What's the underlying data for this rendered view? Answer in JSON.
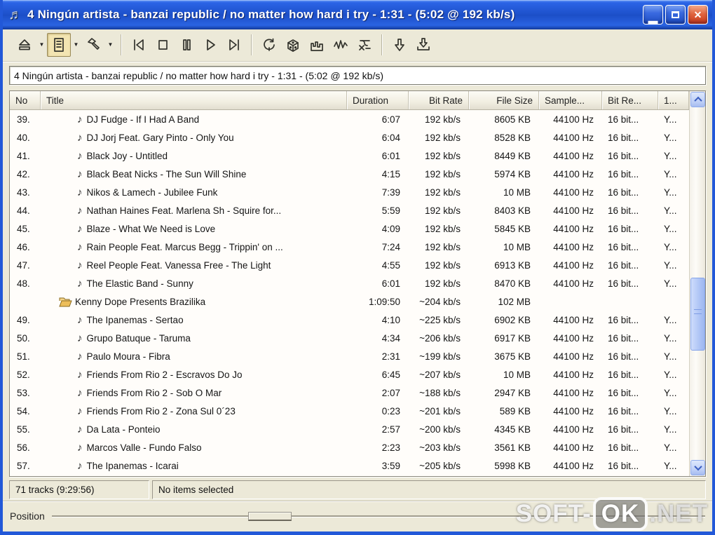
{
  "window": {
    "title": "4 Ningún artista - banzai republic / no matter how hard i try - 1:31 - (5:02 @ 192 kb/s)",
    "controls": {
      "minimize": "_",
      "maximize": "",
      "close": "X"
    }
  },
  "toolbar": {
    "icons": [
      "eject",
      "playlist-view",
      "tools",
      "previous-track",
      "stop",
      "pause",
      "play",
      "next-track",
      "repeat",
      "shuffle-dice",
      "spectrum",
      "waveform",
      "cut",
      "download-arrow",
      "save-arrow"
    ],
    "active_button": "playlist-view"
  },
  "now_playing_field": {
    "value": "4 Ningún artista - banzai republic / no matter how hard i try - 1:31 - (5:02 @ 192 kb/s)"
  },
  "playlist": {
    "columns": [
      {
        "label": "No",
        "align": "l"
      },
      {
        "label": "Title",
        "align": "l"
      },
      {
        "label": "Duration",
        "align": "l"
      },
      {
        "label": "Bit Rate",
        "align": "r"
      },
      {
        "label": "File Size",
        "align": "r"
      },
      {
        "label": "Sample...",
        "align": "l"
      },
      {
        "label": "Bit Re...",
        "align": "l"
      },
      {
        "label": "1...",
        "align": "l"
      }
    ],
    "rows": [
      {
        "no": "39.",
        "type": "track",
        "title": "DJ Fudge - If I Had A Band",
        "duration": "6:07",
        "bitrate": "192 kb/s",
        "size": "8605 KB",
        "sample": "44100 Hz",
        "bits": "16 bit...",
        "more": "Y..."
      },
      {
        "no": "40.",
        "type": "track",
        "title": "DJ Jorj Feat. Gary Pinto - Only You",
        "duration": "6:04",
        "bitrate": "192 kb/s",
        "size": "8528 KB",
        "sample": "44100 Hz",
        "bits": "16 bit...",
        "more": "Y..."
      },
      {
        "no": "41.",
        "type": "track",
        "title": "Black Joy - Untitled",
        "duration": "6:01",
        "bitrate": "192 kb/s",
        "size": "8449 KB",
        "sample": "44100 Hz",
        "bits": "16 bit...",
        "more": "Y..."
      },
      {
        "no": "42.",
        "type": "track",
        "title": "Black Beat Nicks - The Sun Will Shine",
        "duration": "4:15",
        "bitrate": "192 kb/s",
        "size": "5974 KB",
        "sample": "44100 Hz",
        "bits": "16 bit...",
        "more": "Y..."
      },
      {
        "no": "43.",
        "type": "track",
        "title": "Nikos & Lamech - Jubilee Funk",
        "duration": "7:39",
        "bitrate": "192 kb/s",
        "size": "10 MB",
        "sample": "44100 Hz",
        "bits": "16 bit...",
        "more": "Y..."
      },
      {
        "no": "44.",
        "type": "track",
        "title": "Nathan Haines Feat. Marlena Sh - Squire for...",
        "duration": "5:59",
        "bitrate": "192 kb/s",
        "size": "8403 KB",
        "sample": "44100 Hz",
        "bits": "16 bit...",
        "more": "Y..."
      },
      {
        "no": "45.",
        "type": "track",
        "title": "Blaze - What We Need is Love",
        "duration": "4:09",
        "bitrate": "192 kb/s",
        "size": "5845 KB",
        "sample": "44100 Hz",
        "bits": "16 bit...",
        "more": "Y..."
      },
      {
        "no": "46.",
        "type": "track",
        "title": "Rain People Feat. Marcus Begg - Trippin' on ...",
        "duration": "7:24",
        "bitrate": "192 kb/s",
        "size": "10 MB",
        "sample": "44100 Hz",
        "bits": "16 bit...",
        "more": "Y..."
      },
      {
        "no": "47.",
        "type": "track",
        "title": "Reel People Feat. Vanessa Free - The Light",
        "duration": "4:55",
        "bitrate": "192 kb/s",
        "size": "6913 KB",
        "sample": "44100 Hz",
        "bits": "16 bit...",
        "more": "Y..."
      },
      {
        "no": "48.",
        "type": "track",
        "title": "The Elastic Band - Sunny",
        "duration": "6:01",
        "bitrate": "192 kb/s",
        "size": "8470 KB",
        "sample": "44100 Hz",
        "bits": "16 bit...",
        "more": "Y..."
      },
      {
        "no": "",
        "type": "folder",
        "title": "Kenny Dope Presents Brazilika",
        "duration": "1:09:50",
        "bitrate": "~204 kb/s",
        "size": "102 MB",
        "sample": "",
        "bits": "",
        "more": ""
      },
      {
        "no": "49.",
        "type": "track",
        "title": "The Ipanemas - Sertao",
        "duration": "4:10",
        "bitrate": "~225 kb/s",
        "size": "6902 KB",
        "sample": "44100 Hz",
        "bits": "16 bit...",
        "more": "Y..."
      },
      {
        "no": "50.",
        "type": "track",
        "title": "Grupo Batuque - Taruma",
        "duration": "4:34",
        "bitrate": "~206 kb/s",
        "size": "6917 KB",
        "sample": "44100 Hz",
        "bits": "16 bit...",
        "more": "Y..."
      },
      {
        "no": "51.",
        "type": "track",
        "title": "Paulo Moura - Fibra",
        "duration": "2:31",
        "bitrate": "~199 kb/s",
        "size": "3675 KB",
        "sample": "44100 Hz",
        "bits": "16 bit...",
        "more": "Y..."
      },
      {
        "no": "52.",
        "type": "track",
        "title": "Friends From Rio 2 - Escravos Do Jo",
        "duration": "6:45",
        "bitrate": "~207 kb/s",
        "size": "10 MB",
        "sample": "44100 Hz",
        "bits": "16 bit...",
        "more": "Y..."
      },
      {
        "no": "53.",
        "type": "track",
        "title": "Friends From Rio 2 - Sob O Mar",
        "duration": "2:07",
        "bitrate": "~188 kb/s",
        "size": "2947 KB",
        "sample": "44100 Hz",
        "bits": "16 bit...",
        "more": "Y..."
      },
      {
        "no": "54.",
        "type": "track",
        "title": "Friends From Rio 2 - Zona Sul 0´23",
        "duration": "0:23",
        "bitrate": "~201 kb/s",
        "size": "589 KB",
        "sample": "44100 Hz",
        "bits": "16 bit...",
        "more": "Y..."
      },
      {
        "no": "55.",
        "type": "track",
        "title": "Da Lata - Ponteio",
        "duration": "2:57",
        "bitrate": "~200 kb/s",
        "size": "4345 KB",
        "sample": "44100 Hz",
        "bits": "16 bit...",
        "more": "Y..."
      },
      {
        "no": "56.",
        "type": "track",
        "title": "Marcos Valle - Fundo Falso",
        "duration": "2:23",
        "bitrate": "~203 kb/s",
        "size": "3561 KB",
        "sample": "44100 Hz",
        "bits": "16 bit...",
        "more": "Y..."
      },
      {
        "no": "57.",
        "type": "track",
        "title": "The Ipanemas - Icarai",
        "duration": "3:59",
        "bitrate": "~205 kb/s",
        "size": "5998 KB",
        "sample": "44100 Hz",
        "bits": "16 bit...",
        "more": "Y..."
      }
    ]
  },
  "status_bar": {
    "tracks_summary": "71 tracks (9:29:56)",
    "selection": "No items selected"
  },
  "position_bar": {
    "label": "Position"
  },
  "watermark": {
    "left": "SOFT-",
    "badge": "OK",
    "right": ".NET"
  },
  "colors": {
    "titlebar_blue": "#1c4fc8",
    "close_red": "#d84b24",
    "window_beige": "#ece9d8",
    "table_bg": "#fffdfa",
    "active_button_tan": "#f3e5b2",
    "scrollbar_blue": "#b2c7f6"
  }
}
